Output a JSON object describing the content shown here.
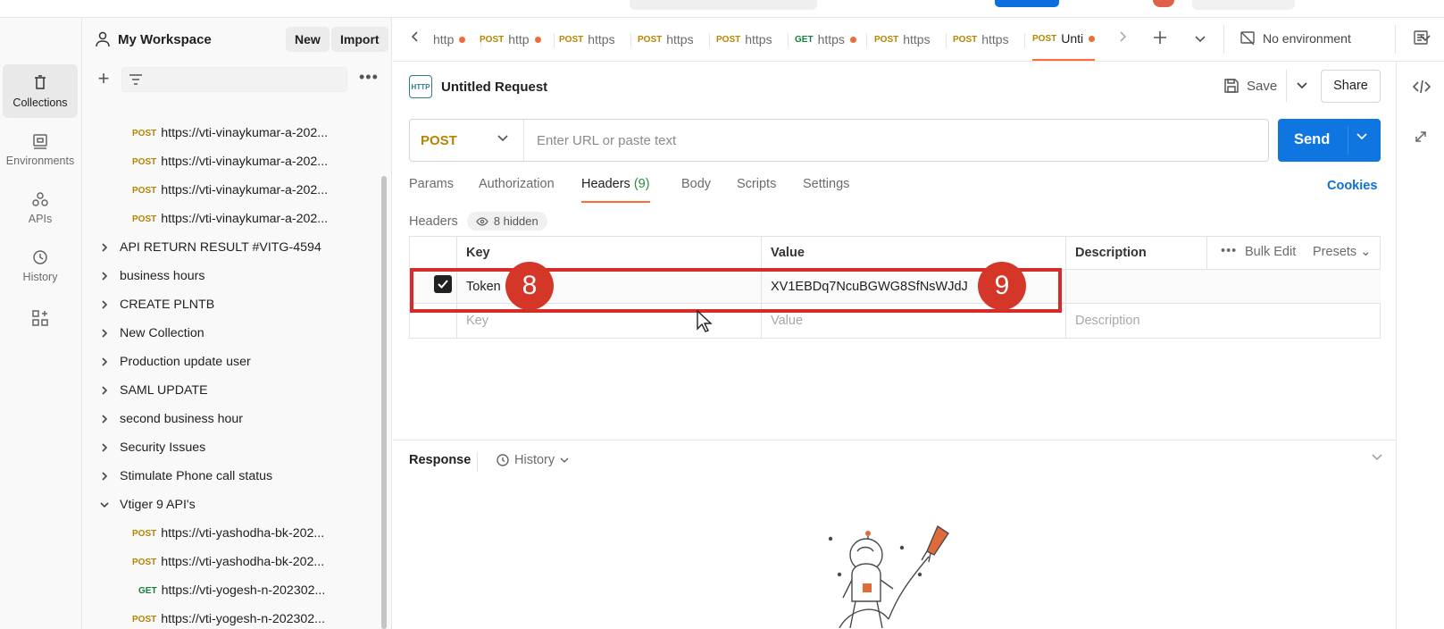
{
  "workspace": {
    "name": "My Workspace",
    "new_label": "New",
    "import_label": "Import"
  },
  "rail": [
    {
      "label": "Collections",
      "icon": "trash-can-icon"
    },
    {
      "label": "Environments",
      "icon": "environment-icon"
    },
    {
      "label": "APIs",
      "icon": "apis-icon"
    },
    {
      "label": "History",
      "icon": "history-icon"
    }
  ],
  "sidebar": {
    "items": [
      {
        "method": "POST",
        "label": "https://vti-vinaykumar-a-202..."
      },
      {
        "method": "POST",
        "label": "https://vti-vinaykumar-a-202..."
      },
      {
        "method": "POST",
        "label": "https://vti-vinaykumar-a-202..."
      },
      {
        "method": "POST",
        "label": "https://vti-vinaykumar-a-202..."
      },
      {
        "folder": "API RETURN RESULT #VITG-4594"
      },
      {
        "folder": "business hours"
      },
      {
        "folder": "CREATE PLNTB"
      },
      {
        "folder": "New Collection"
      },
      {
        "folder": "Production update user"
      },
      {
        "folder": "SAML UPDATE"
      },
      {
        "folder": "second business hour"
      },
      {
        "folder": "Security Issues"
      },
      {
        "folder": "Stimulate Phone call status"
      },
      {
        "folder": "Vtiger 9 API's"
      },
      {
        "method": "POST",
        "label": "https://vti-yashodha-bk-202..."
      },
      {
        "method": "POST",
        "label": "https://vti-yashodha-bk-202..."
      },
      {
        "method": "GET",
        "label": "https://vti-yogesh-n-202302..."
      },
      {
        "method": "POST",
        "label": "https://vti-yogesh-n-202302..."
      }
    ]
  },
  "tabs": [
    {
      "method": "",
      "label": "http"
    },
    {
      "method": "POST",
      "label": "http"
    },
    {
      "method": "POST",
      "label": "https"
    },
    {
      "method": "POST",
      "label": "https"
    },
    {
      "method": "POST",
      "label": "https"
    },
    {
      "method": "GET",
      "label": "https"
    },
    {
      "method": "POST",
      "label": "https"
    },
    {
      "method": "POST",
      "label": "https"
    },
    {
      "method": "POST",
      "label": "Unti"
    }
  ],
  "environment": {
    "label": "No environment"
  },
  "request": {
    "title": "Untitled Request",
    "badge": "HTTP",
    "save_label": "Save",
    "share_label": "Share",
    "method": "POST",
    "url_placeholder": "Enter URL or paste text",
    "send_label": "Send",
    "tabs": {
      "params": "Params",
      "authorization": "Authorization",
      "headers": "Headers",
      "headers_count": "(9)",
      "body": "Body",
      "scripts": "Scripts",
      "settings": "Settings"
    },
    "cookies_label": "Cookies"
  },
  "headers": {
    "title": "Headers",
    "hidden_label": "8 hidden",
    "col_key": "Key",
    "col_value": "Value",
    "col_description": "Description",
    "bulk_edit": "Bulk Edit",
    "presets": "Presets",
    "row": {
      "key": "Token",
      "value": "XV1EBDq7NcuBGWG8SfNsWJdJ",
      "checked": true
    },
    "placeholder_key": "Key",
    "placeholder_value": "Value",
    "placeholder_description": "Description"
  },
  "annotations": {
    "badge_8": "8",
    "badge_9": "9"
  },
  "response": {
    "title": "Response",
    "history_label": "History"
  },
  "colors": {
    "accent": "#ff6c37",
    "send": "#0f75e0",
    "post": "#b58400",
    "get": "#13803d",
    "highlight": "#d62b2b"
  }
}
